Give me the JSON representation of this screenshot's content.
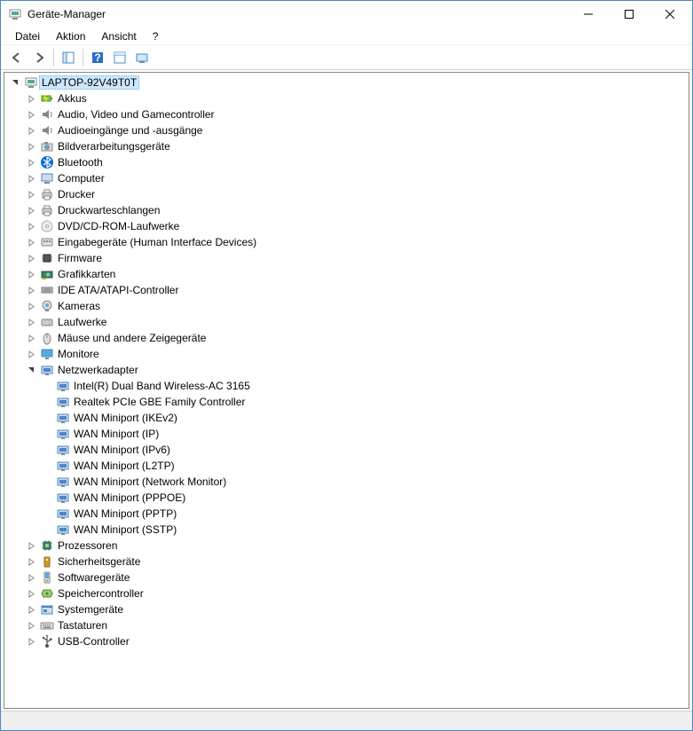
{
  "window": {
    "title": "Geräte-Manager"
  },
  "menu": {
    "datei": "Datei",
    "aktion": "Aktion",
    "ansicht": "Ansicht",
    "help": "?"
  },
  "tree": {
    "root": {
      "label": "LAPTOP-92V49T0T",
      "expanded": true,
      "icon": "computer",
      "selected": true
    },
    "categories": [
      {
        "label": "Akkus",
        "icon": "battery",
        "expanded": false
      },
      {
        "label": "Audio, Video und Gamecontroller",
        "icon": "audio",
        "expanded": false
      },
      {
        "label": "Audioeingänge und -ausgänge",
        "icon": "audio",
        "expanded": false
      },
      {
        "label": "Bildverarbeitungsgeräte",
        "icon": "camera",
        "expanded": false
      },
      {
        "label": "Bluetooth",
        "icon": "bluetooth",
        "expanded": false
      },
      {
        "label": "Computer",
        "icon": "pc",
        "expanded": false
      },
      {
        "label": "Drucker",
        "icon": "printer",
        "expanded": false
      },
      {
        "label": "Druckwarteschlangen",
        "icon": "printer",
        "expanded": false
      },
      {
        "label": "DVD/CD-ROM-Laufwerke",
        "icon": "disc",
        "expanded": false
      },
      {
        "label": "Eingabegeräte (Human Interface Devices)",
        "icon": "hid",
        "expanded": false
      },
      {
        "label": "Firmware",
        "icon": "chip",
        "expanded": false
      },
      {
        "label": "Grafikkarten",
        "icon": "gpu",
        "expanded": false
      },
      {
        "label": "IDE ATA/ATAPI-Controller",
        "icon": "ide",
        "expanded": false
      },
      {
        "label": "Kameras",
        "icon": "webcam",
        "expanded": false
      },
      {
        "label": "Laufwerke",
        "icon": "drive",
        "expanded": false
      },
      {
        "label": "Mäuse und andere Zeigegeräte",
        "icon": "mouse",
        "expanded": false
      },
      {
        "label": "Monitore",
        "icon": "monitor",
        "expanded": false
      },
      {
        "label": "Netzwerkadapter",
        "icon": "network",
        "expanded": true,
        "children": [
          {
            "label": "Intel(R) Dual Band Wireless-AC 3165",
            "icon": "network"
          },
          {
            "label": "Realtek PCIe GBE Family Controller",
            "icon": "network"
          },
          {
            "label": "WAN Miniport (IKEv2)",
            "icon": "network"
          },
          {
            "label": "WAN Miniport (IP)",
            "icon": "network"
          },
          {
            "label": "WAN Miniport (IPv6)",
            "icon": "network"
          },
          {
            "label": "WAN Miniport (L2TP)",
            "icon": "network"
          },
          {
            "label": "WAN Miniport (Network Monitor)",
            "icon": "network"
          },
          {
            "label": "WAN Miniport (PPPOE)",
            "icon": "network"
          },
          {
            "label": "WAN Miniport (PPTP)",
            "icon": "network"
          },
          {
            "label": "WAN Miniport (SSTP)",
            "icon": "network"
          }
        ]
      },
      {
        "label": "Prozessoren",
        "icon": "cpu",
        "expanded": false
      },
      {
        "label": "Sicherheitsgeräte",
        "icon": "security",
        "expanded": false
      },
      {
        "label": "Softwaregeräte",
        "icon": "software",
        "expanded": false
      },
      {
        "label": "Speichercontroller",
        "icon": "storage",
        "expanded": false
      },
      {
        "label": "Systemgeräte",
        "icon": "system",
        "expanded": false
      },
      {
        "label": "Tastaturen",
        "icon": "keyboard",
        "expanded": false
      },
      {
        "label": "USB-Controller",
        "icon": "usb",
        "expanded": false
      }
    ]
  }
}
